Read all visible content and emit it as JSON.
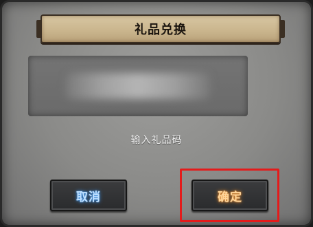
{
  "dialog": {
    "title": "礼品兑换",
    "input_placeholder": "输入礼品码"
  },
  "buttons": {
    "cancel_label": "取消",
    "confirm_label": "确定"
  },
  "colors": {
    "highlight": "#e41b1b",
    "cancel_glow": "#3a8fe8",
    "confirm_glow": "#e88a2a"
  }
}
